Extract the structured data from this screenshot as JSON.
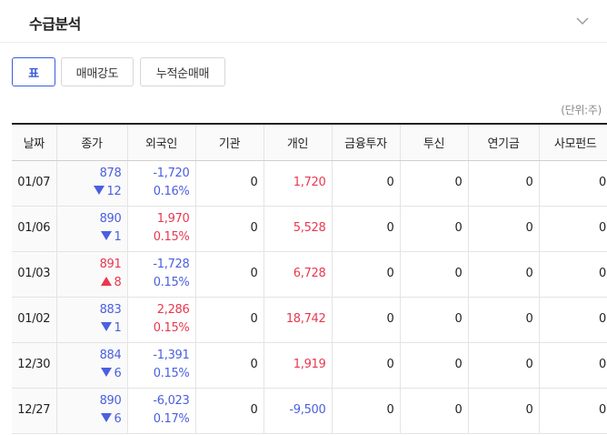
{
  "title": "수급분석",
  "colors": {
    "up": "#e8384f",
    "down": "#4a5fe0",
    "accent": "#3b5bdb"
  },
  "tabs": [
    {
      "label": "표",
      "active": true
    },
    {
      "label": "매매강도",
      "active": false
    },
    {
      "label": "누적순매매",
      "active": false
    }
  ],
  "unit_label": "(단위:주)",
  "columns": [
    "날짜",
    "종가",
    "외국인",
    "기관",
    "개인",
    "금융투자",
    "투신",
    "연기금",
    "사모펀드"
  ],
  "rows": [
    {
      "date": "01/07",
      "close": "878",
      "change_dir": "down",
      "change": "12",
      "foreign": "-1,720",
      "foreign_dir": "down",
      "foreign_pct": "0.16%",
      "inst": "0",
      "indiv": "1,720",
      "indiv_dir": "up",
      "fin": "0",
      "trust": "0",
      "pension": "0",
      "pef": "0"
    },
    {
      "date": "01/06",
      "close": "890",
      "change_dir": "down",
      "change": "1",
      "foreign": "1,970",
      "foreign_dir": "up",
      "foreign_pct": "0.15%",
      "inst": "0",
      "indiv": "5,528",
      "indiv_dir": "up",
      "fin": "0",
      "trust": "0",
      "pension": "0",
      "pef": "0"
    },
    {
      "date": "01/03",
      "close": "891",
      "change_dir": "up",
      "change": "8",
      "foreign": "-1,728",
      "foreign_dir": "down",
      "foreign_pct": "0.15%",
      "inst": "0",
      "indiv": "6,728",
      "indiv_dir": "up",
      "fin": "0",
      "trust": "0",
      "pension": "0",
      "pef": "0"
    },
    {
      "date": "01/02",
      "close": "883",
      "change_dir": "down",
      "change": "1",
      "foreign": "2,286",
      "foreign_dir": "up",
      "foreign_pct": "0.15%",
      "inst": "0",
      "indiv": "18,742",
      "indiv_dir": "up",
      "fin": "0",
      "trust": "0",
      "pension": "0",
      "pef": "0"
    },
    {
      "date": "12/30",
      "close": "884",
      "change_dir": "down",
      "change": "6",
      "foreign": "-1,391",
      "foreign_dir": "down",
      "foreign_pct": "0.15%",
      "inst": "0",
      "indiv": "1,919",
      "indiv_dir": "up",
      "fin": "0",
      "trust": "0",
      "pension": "0",
      "pef": "0"
    },
    {
      "date": "12/27",
      "close": "890",
      "change_dir": "down",
      "change": "6",
      "foreign": "-6,023",
      "foreign_dir": "down",
      "foreign_pct": "0.17%",
      "inst": "0",
      "indiv": "-9,500",
      "indiv_dir": "down",
      "fin": "0",
      "trust": "0",
      "pension": "0",
      "pef": "0"
    }
  ]
}
